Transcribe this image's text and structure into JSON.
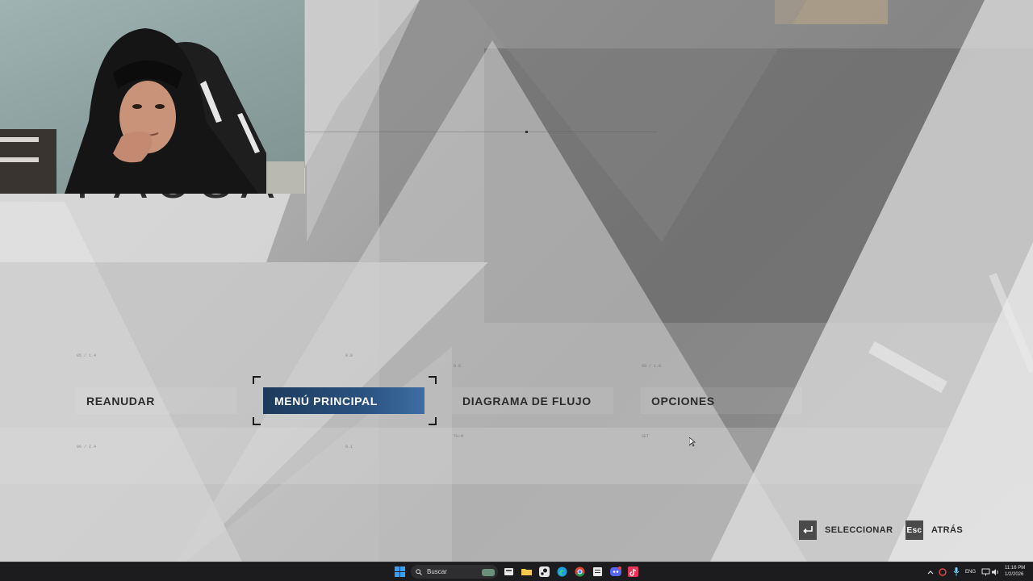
{
  "pause": {
    "title": "PAUSA"
  },
  "menu": {
    "items": [
      {
        "label": "REANUDAR",
        "selected": false
      },
      {
        "label": "MENÚ PRINCIPAL",
        "selected": true
      },
      {
        "label": "DIAGRAMA DE FLUJO",
        "selected": false
      },
      {
        "label": "OPCIONES",
        "selected": false
      }
    ]
  },
  "prompts": {
    "select": {
      "key_icon": "enter-key-icon",
      "label": "SELECCIONAR"
    },
    "back": {
      "key": "Esc",
      "label": "ATRÁS"
    }
  },
  "taskbar": {
    "search_label": "Buscar",
    "apps": [
      "windows-start-icon",
      "search-icon",
      "widgets-icon",
      "task-view-icon",
      "file-explorer-icon",
      "steam-icon",
      "edge-icon",
      "chrome-icon",
      "notepad-icon",
      "discord-icon",
      "tiktok-icon"
    ],
    "language": "ENG",
    "time": "11:16 PM",
    "date": "1/2/2026"
  },
  "colors": {
    "selected_gradient_start": "#1d3a5c",
    "selected_gradient_end": "#3d6ea4",
    "menu_text": "#2c2c2c",
    "taskbar_bg": "#1c1c1e"
  }
}
